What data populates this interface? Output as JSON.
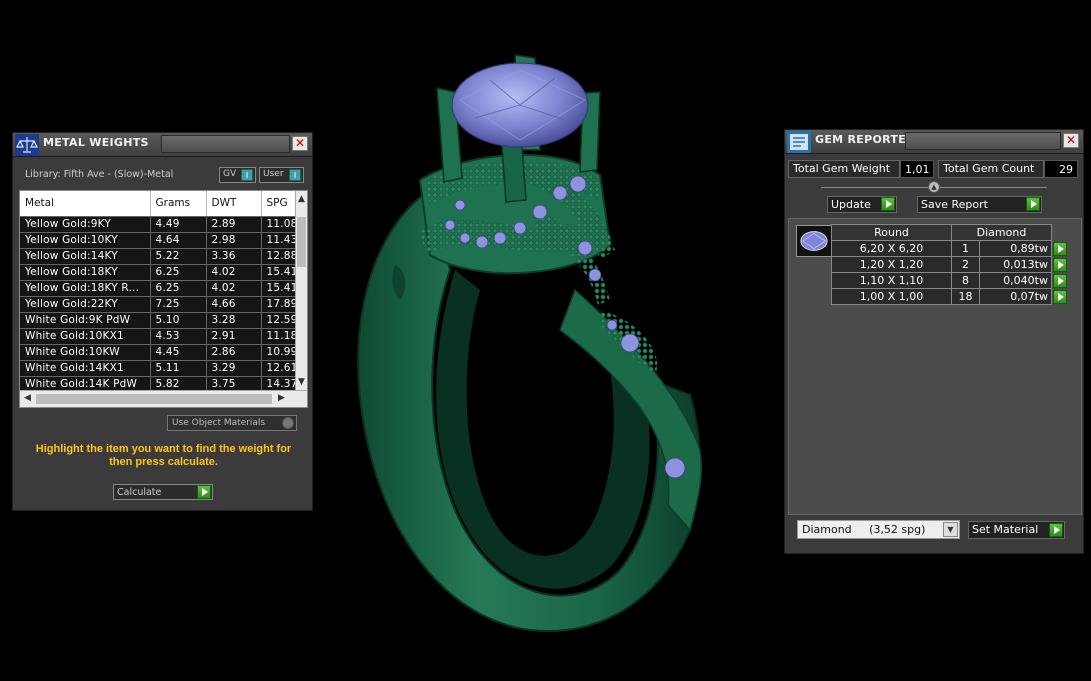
{
  "metal_weights": {
    "title": "METAL WEIGHTS",
    "library": "Library: Fifth Ave - (Slow)-Metal",
    "gv_label": "GV",
    "user_label": "User",
    "columns": [
      "Metal",
      "Grams",
      "DWT",
      "SPG"
    ],
    "rows": [
      [
        "Yellow Gold:9KY",
        "4.49",
        "2.89",
        "11.08"
      ],
      [
        "Yellow Gold:10KY",
        "4.64",
        "2.98",
        "11.43"
      ],
      [
        "Yellow Gold:14KY",
        "5.22",
        "3.36",
        "12.88"
      ],
      [
        "Yellow Gold:18KY",
        "6.25",
        "4.02",
        "15.41"
      ],
      [
        "Yellow Gold:18KY R...",
        "6.25",
        "4.02",
        "15.41"
      ],
      [
        "Yellow Gold:22KY",
        "7.25",
        "4.66",
        "17.89"
      ],
      [
        "White Gold:9K PdW",
        "5.10",
        "3.28",
        "12.59"
      ],
      [
        "White Gold:10KX1",
        "4.53",
        "2.91",
        "11.18"
      ],
      [
        "White Gold:10KW",
        "4.45",
        "2.86",
        "10.99"
      ],
      [
        "White Gold:14KX1",
        "5.11",
        "3.29",
        "12.61"
      ],
      [
        "White Gold:14K PdW",
        "5.82",
        "3.75",
        "14.37"
      ]
    ],
    "use_object_materials": "Use Object Materials",
    "hint": "Highlight the item you want to find the weight for then press calculate.",
    "calculate_label": "Calculate"
  },
  "gem_reporter": {
    "title": "GEM REPORTER",
    "total_gem_weight_label": "Total Gem Weight",
    "total_gem_weight": "1,01",
    "total_gem_count_label": "Total Gem Count",
    "total_gem_count": "29",
    "update_label": "Update",
    "save_report_label": "Save Report",
    "table_header": [
      "Round",
      "Diamond"
    ],
    "rows": [
      [
        "6,20 X 6,20",
        "1",
        "0,89tw"
      ],
      [
        "1,20 X 1,20",
        "2",
        "0,013tw"
      ],
      [
        "1,10 X 1,10",
        "8",
        "0,040tw"
      ],
      [
        "1,00 X 1,00",
        "18",
        "0,07tw"
      ]
    ],
    "material_select": "Diamond     (3,52 spg)",
    "set_material_label": "Set Material"
  },
  "colors": {
    "ring_metal": "#1d6b4a",
    "gem": "#7f86d6",
    "hint_text": "#ffc51c",
    "accent_green": "#3aa82a"
  }
}
